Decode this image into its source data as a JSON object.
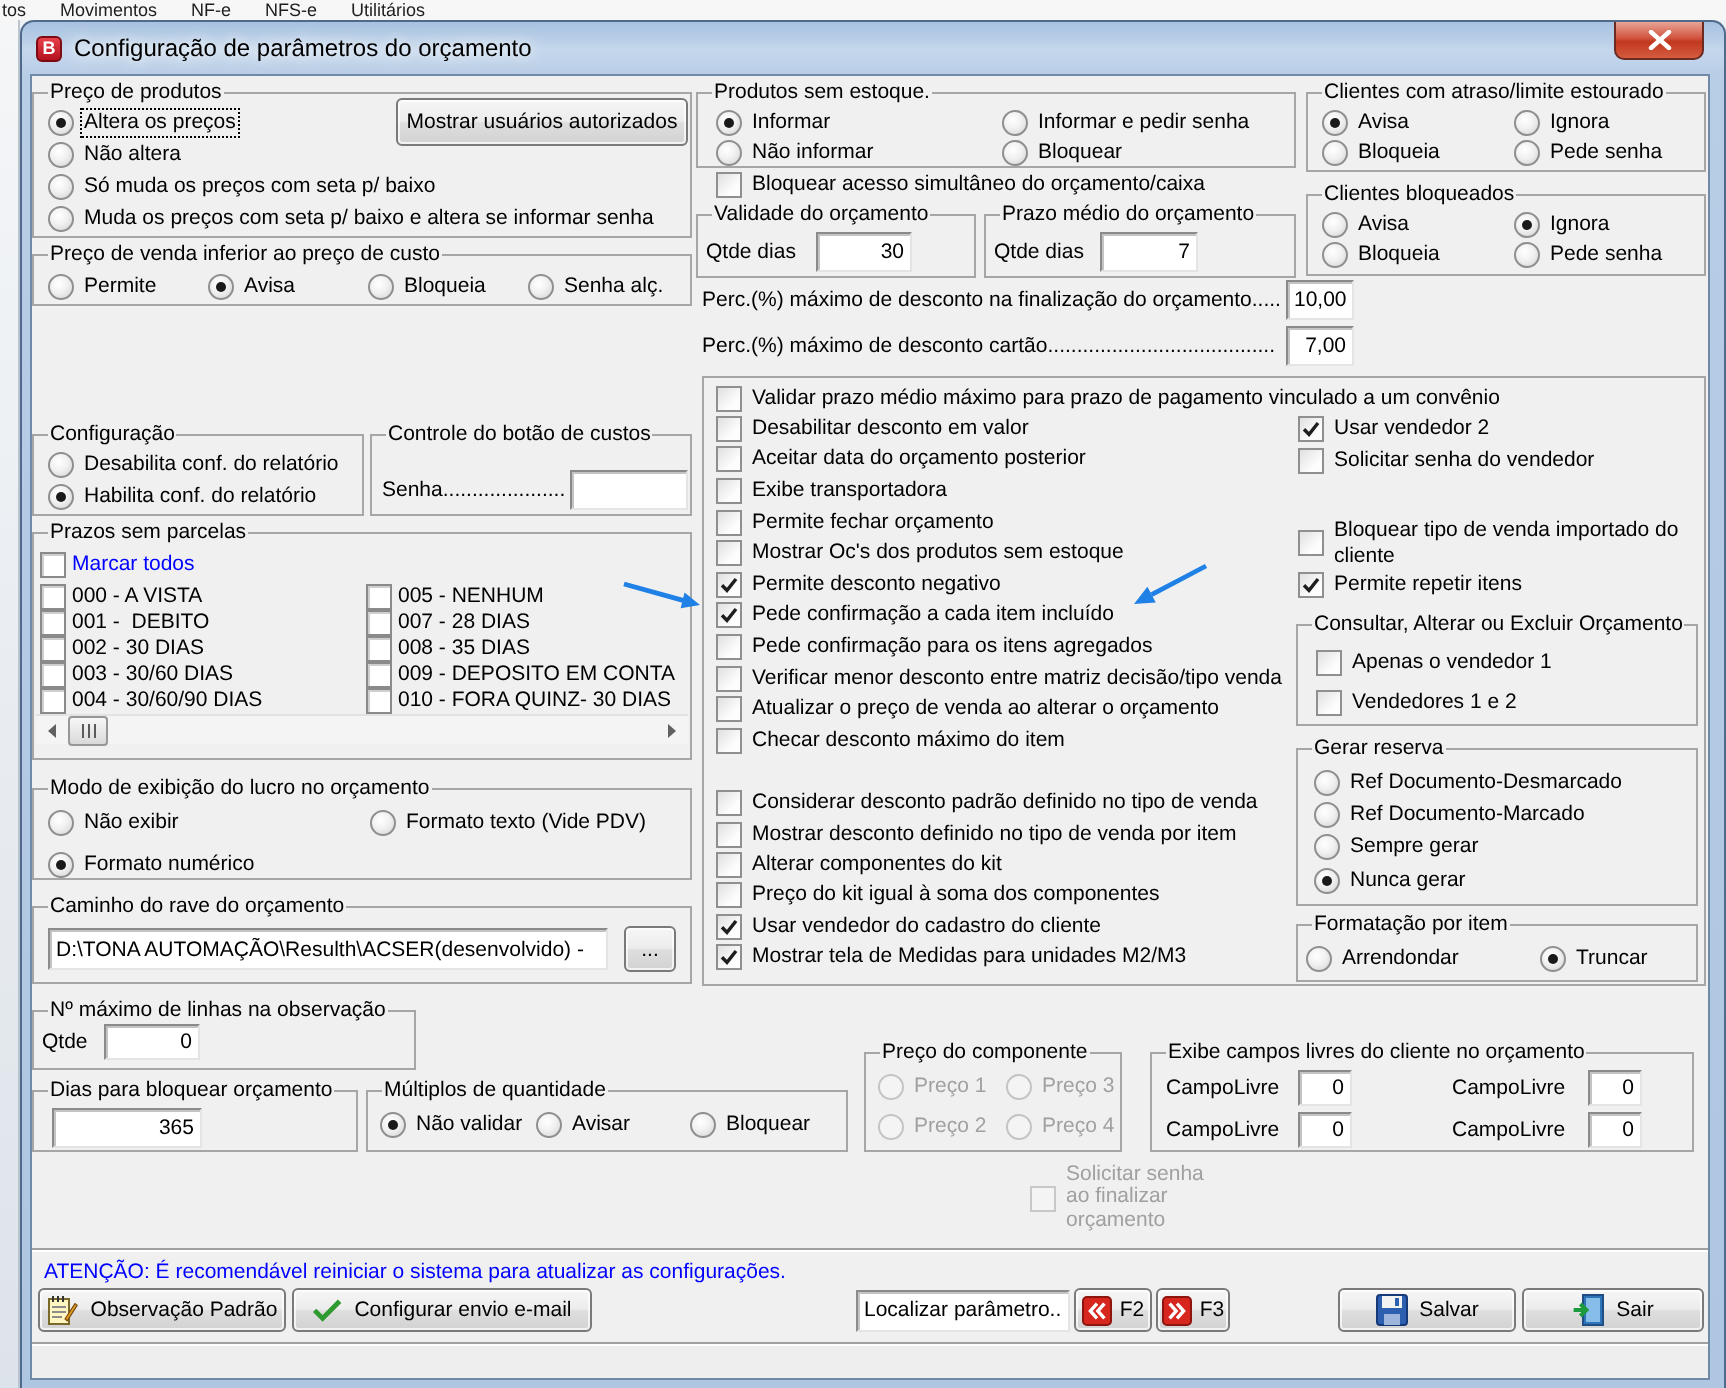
{
  "background_menu": [
    "tos",
    "Movimentos",
    "NF-e",
    "NFS-e",
    "Utilitários"
  ],
  "window": {
    "icon_letter": "B",
    "title": "Configuração de parâmetros do orçamento"
  },
  "product_prices": {
    "title": "Preço de produtos",
    "options": [
      {
        "label": "Altera os preços",
        "selected": true,
        "focused": true
      },
      {
        "label": "Não altera",
        "selected": false,
        "focused": false
      },
      {
        "label": "Só muda os preços com seta p/ baixo",
        "selected": false,
        "focused": false
      },
      {
        "label": "Muda os preços com seta p/ baixo e altera se informar senha",
        "selected": false,
        "focused": false
      }
    ],
    "button": "Mostrar usuários autorizados"
  },
  "below_cost_price": {
    "title": "Preço de venda inferior ao preço de custo",
    "options": [
      {
        "label": "Permite",
        "selected": false
      },
      {
        "label": "Avisa",
        "selected": true
      },
      {
        "label": "Bloqueia",
        "selected": false
      },
      {
        "label": "Senha alç.",
        "selected": false
      }
    ]
  },
  "report_config": {
    "title": "Configuração",
    "options": [
      {
        "label": "Desabilita conf. do relatório",
        "selected": false
      },
      {
        "label": "Habilita conf. do relatório",
        "selected": true
      }
    ]
  },
  "cost_button_control": {
    "title": "Controle do botão de custos",
    "label": "Senha....................."
  },
  "terms_without_installments": {
    "title": "Prazos sem parcelas",
    "mark_all": {
      "label": "Marcar todos",
      "checked": false
    },
    "items": [
      {
        "label": "000 - A VISTA",
        "checked": false
      },
      {
        "label": "001 -  DEBITO",
        "checked": false
      },
      {
        "label": "002 - 30 DIAS",
        "checked": false
      },
      {
        "label": "003 - 30/60 DIAS",
        "checked": false
      },
      {
        "label": "004 - 30/60/90 DIAS",
        "checked": false
      },
      {
        "label": "005 - NENHUM",
        "checked": false
      },
      {
        "label": "007 - 28 DIAS",
        "checked": false
      },
      {
        "label": "008 - 35 DIAS",
        "checked": false
      },
      {
        "label": "009 - DEPOSITO EM CONTA",
        "checked": false
      },
      {
        "label": "010 - FORA QUINZ- 30 DIAS",
        "checked": false
      }
    ]
  },
  "profit_display": {
    "title": "Modo de exibição do lucro no orçamento",
    "options": [
      {
        "label": "Não exibir",
        "selected": false
      },
      {
        "label": "Formato texto (Vide PDV)",
        "selected": false
      },
      {
        "label": "Formato numérico",
        "selected": true
      }
    ]
  },
  "rave_path": {
    "title": "Caminho do rave do orçamento",
    "value": "D:\\TONA AUTOMAÇÃO\\Resulth\\ACSER(desenvolvido) -",
    "button": "..."
  },
  "out_of_stock": {
    "title": "Produtos sem estoque.",
    "options": [
      {
        "label": "Informar",
        "selected": true
      },
      {
        "label": "Informar e pedir senha",
        "selected": false
      },
      {
        "label": "Não informar",
        "selected": false
      },
      {
        "label": "Bloquear",
        "selected": false
      }
    ]
  },
  "simultaneous_lock": {
    "label": "Bloquear acesso simultâneo do orçamento/caixa",
    "checked": false
  },
  "validity": {
    "title": "Validade do orçamento",
    "label": "Qtde dias",
    "value": "30"
  },
  "average_term": {
    "title": "Prazo médio do orçamento",
    "label": "Qtde dias",
    "value": "7"
  },
  "discount_limits": [
    {
      "label": "Perc.(%) máximo de desconto na finalização do orçamento.....",
      "value": "10,00"
    },
    {
      "label": "Perc.(%) máximo de desconto cartão.......................................",
      "value": "7,00"
    }
  ],
  "late_clients": {
    "title": "Clientes com atraso/limite estourado",
    "options": [
      {
        "label": "Avisa",
        "selected": true
      },
      {
        "label": "Ignora",
        "selected": false
      },
      {
        "label": "Bloqueia",
        "selected": false
      },
      {
        "label": "Pede senha",
        "selected": false
      }
    ]
  },
  "blocked_clients": {
    "title": "Clientes bloqueados",
    "options": [
      {
        "label": "Avisa",
        "selected": false
      },
      {
        "label": "Ignora",
        "selected": true
      },
      {
        "label": "Bloqueia",
        "selected": false
      },
      {
        "label": "Pede senha",
        "selected": false
      }
    ]
  },
  "options_panel": {
    "wide_option": {
      "label": "Validar prazo médio máximo para prazo de pagamento vinculado a um convênio",
      "checked": false
    },
    "left_options": [
      {
        "label": "Desabilitar desconto em valor",
        "checked": false
      },
      {
        "label": "Aceitar data do orçamento posterior",
        "checked": false
      },
      {
        "label": "Exibe transportadora",
        "checked": false
      },
      {
        "label": "Permite fechar orçamento",
        "checked": false
      },
      {
        "label": "Mostrar Oc's dos produtos sem estoque",
        "checked": false
      },
      {
        "label": "Permite desconto negativo",
        "checked": true
      },
      {
        "label": "Pede confirmação a cada item incluído",
        "checked": true
      },
      {
        "label": "Pede confirmação para os itens agregados",
        "checked": false
      },
      {
        "label": "Verificar menor desconto entre matriz decisão/tipo venda",
        "checked": false
      },
      {
        "label": "Atualizar o preço de venda ao alterar o orçamento",
        "checked": false
      },
      {
        "label": "Checar desconto máximo do item",
        "checked": false
      }
    ],
    "lower_options": [
      {
        "label": "Considerar desconto padrão definido no tipo de venda",
        "checked": false
      },
      {
        "label": "Mostrar desconto definido no tipo de venda por item",
        "checked": false
      },
      {
        "label": "Alterar componentes do kit",
        "checked": false
      },
      {
        "label": "Preço do kit igual à soma dos componentes",
        "checked": false
      },
      {
        "label": "Usar vendedor do cadastro do cliente",
        "checked": true
      },
      {
        "label": "Mostrar tela de Medidas para unidades M2/M3",
        "checked": true
      }
    ],
    "right_options": [
      {
        "label": "Usar vendedor 2",
        "checked": true
      },
      {
        "label": "Solicitar senha do vendedor",
        "checked": false
      },
      {
        "label": "Bloquear tipo de venda importado do cliente",
        "checked": false
      },
      {
        "label": "Permite repetir itens",
        "checked": true
      }
    ],
    "edit_permission": {
      "title": "Consultar, Alterar ou Excluir Orçamento",
      "options": [
        {
          "label": "Apenas o vendedor 1",
          "checked": false
        },
        {
          "label": "Vendedores 1 e 2",
          "checked": false
        }
      ]
    },
    "reservation": {
      "title": "Gerar reserva",
      "options": [
        {
          "label": "Ref Documento-Desmarcado",
          "selected": false
        },
        {
          "label": "Ref Documento-Marcado",
          "selected": false
        },
        {
          "label": "Sempre gerar",
          "selected": false
        },
        {
          "label": "Nunca gerar",
          "selected": true
        }
      ]
    },
    "item_formatting": {
      "title": "Formatação por item",
      "options": [
        {
          "label": "Arrendondar",
          "selected": false
        },
        {
          "label": "Truncar",
          "selected": true
        }
      ]
    }
  },
  "max_note_lines": {
    "title": "Nº máximo de linhas na observação",
    "label": "Qtde",
    "value": "0"
  },
  "block_days": {
    "title": "Dias para bloquear orçamento",
    "value": "365"
  },
  "quantity_multiples": {
    "title": "Múltiplos de quantidade",
    "options": [
      {
        "label": "Não validar",
        "selected": true
      },
      {
        "label": "Avisar",
        "selected": false
      },
      {
        "label": "Bloquear",
        "selected": false
      }
    ]
  },
  "component_price": {
    "title": "Preço do componente",
    "options": [
      {
        "label": "Preço 1",
        "selected": false,
        "disabled": true
      },
      {
        "label": "Preço 3",
        "selected": false,
        "disabled": true
      },
      {
        "label": "Preço 2",
        "selected": false,
        "disabled": true
      },
      {
        "label": "Preço 4",
        "selected": false,
        "disabled": true
      }
    ]
  },
  "client_free_fields": {
    "title": "Exibe campos livres do cliente no orçamento",
    "fields": [
      {
        "label": "CampoLivre",
        "value": "0"
      },
      {
        "label": "CampoLivre",
        "value": "0"
      },
      {
        "label": "CampoLivre",
        "value": "0"
      },
      {
        "label": "CampoLivre",
        "value": "0"
      }
    ]
  },
  "finalize_password": {
    "label": "Solicitar senha ao finalizar orçamento",
    "checked": false,
    "disabled": true
  },
  "notice": "ATENÇÃO: É recomendável reiniciar o sistema para atualizar as configurações.",
  "footer_buttons": [
    {
      "kind": "notes",
      "label": "Observação Padrão"
    },
    {
      "kind": "check",
      "label": "Configurar envio e-mail"
    }
  ],
  "search": {
    "placeholder": "Localizar parâmetro..."
  },
  "nav_buttons": [
    {
      "kind": "previous",
      "label": "F2"
    },
    {
      "kind": "next",
      "label": "F3"
    }
  ],
  "action_buttons": [
    {
      "kind": "save",
      "label": "Salvar"
    },
    {
      "kind": "exit",
      "label": "Sair"
    }
  ]
}
